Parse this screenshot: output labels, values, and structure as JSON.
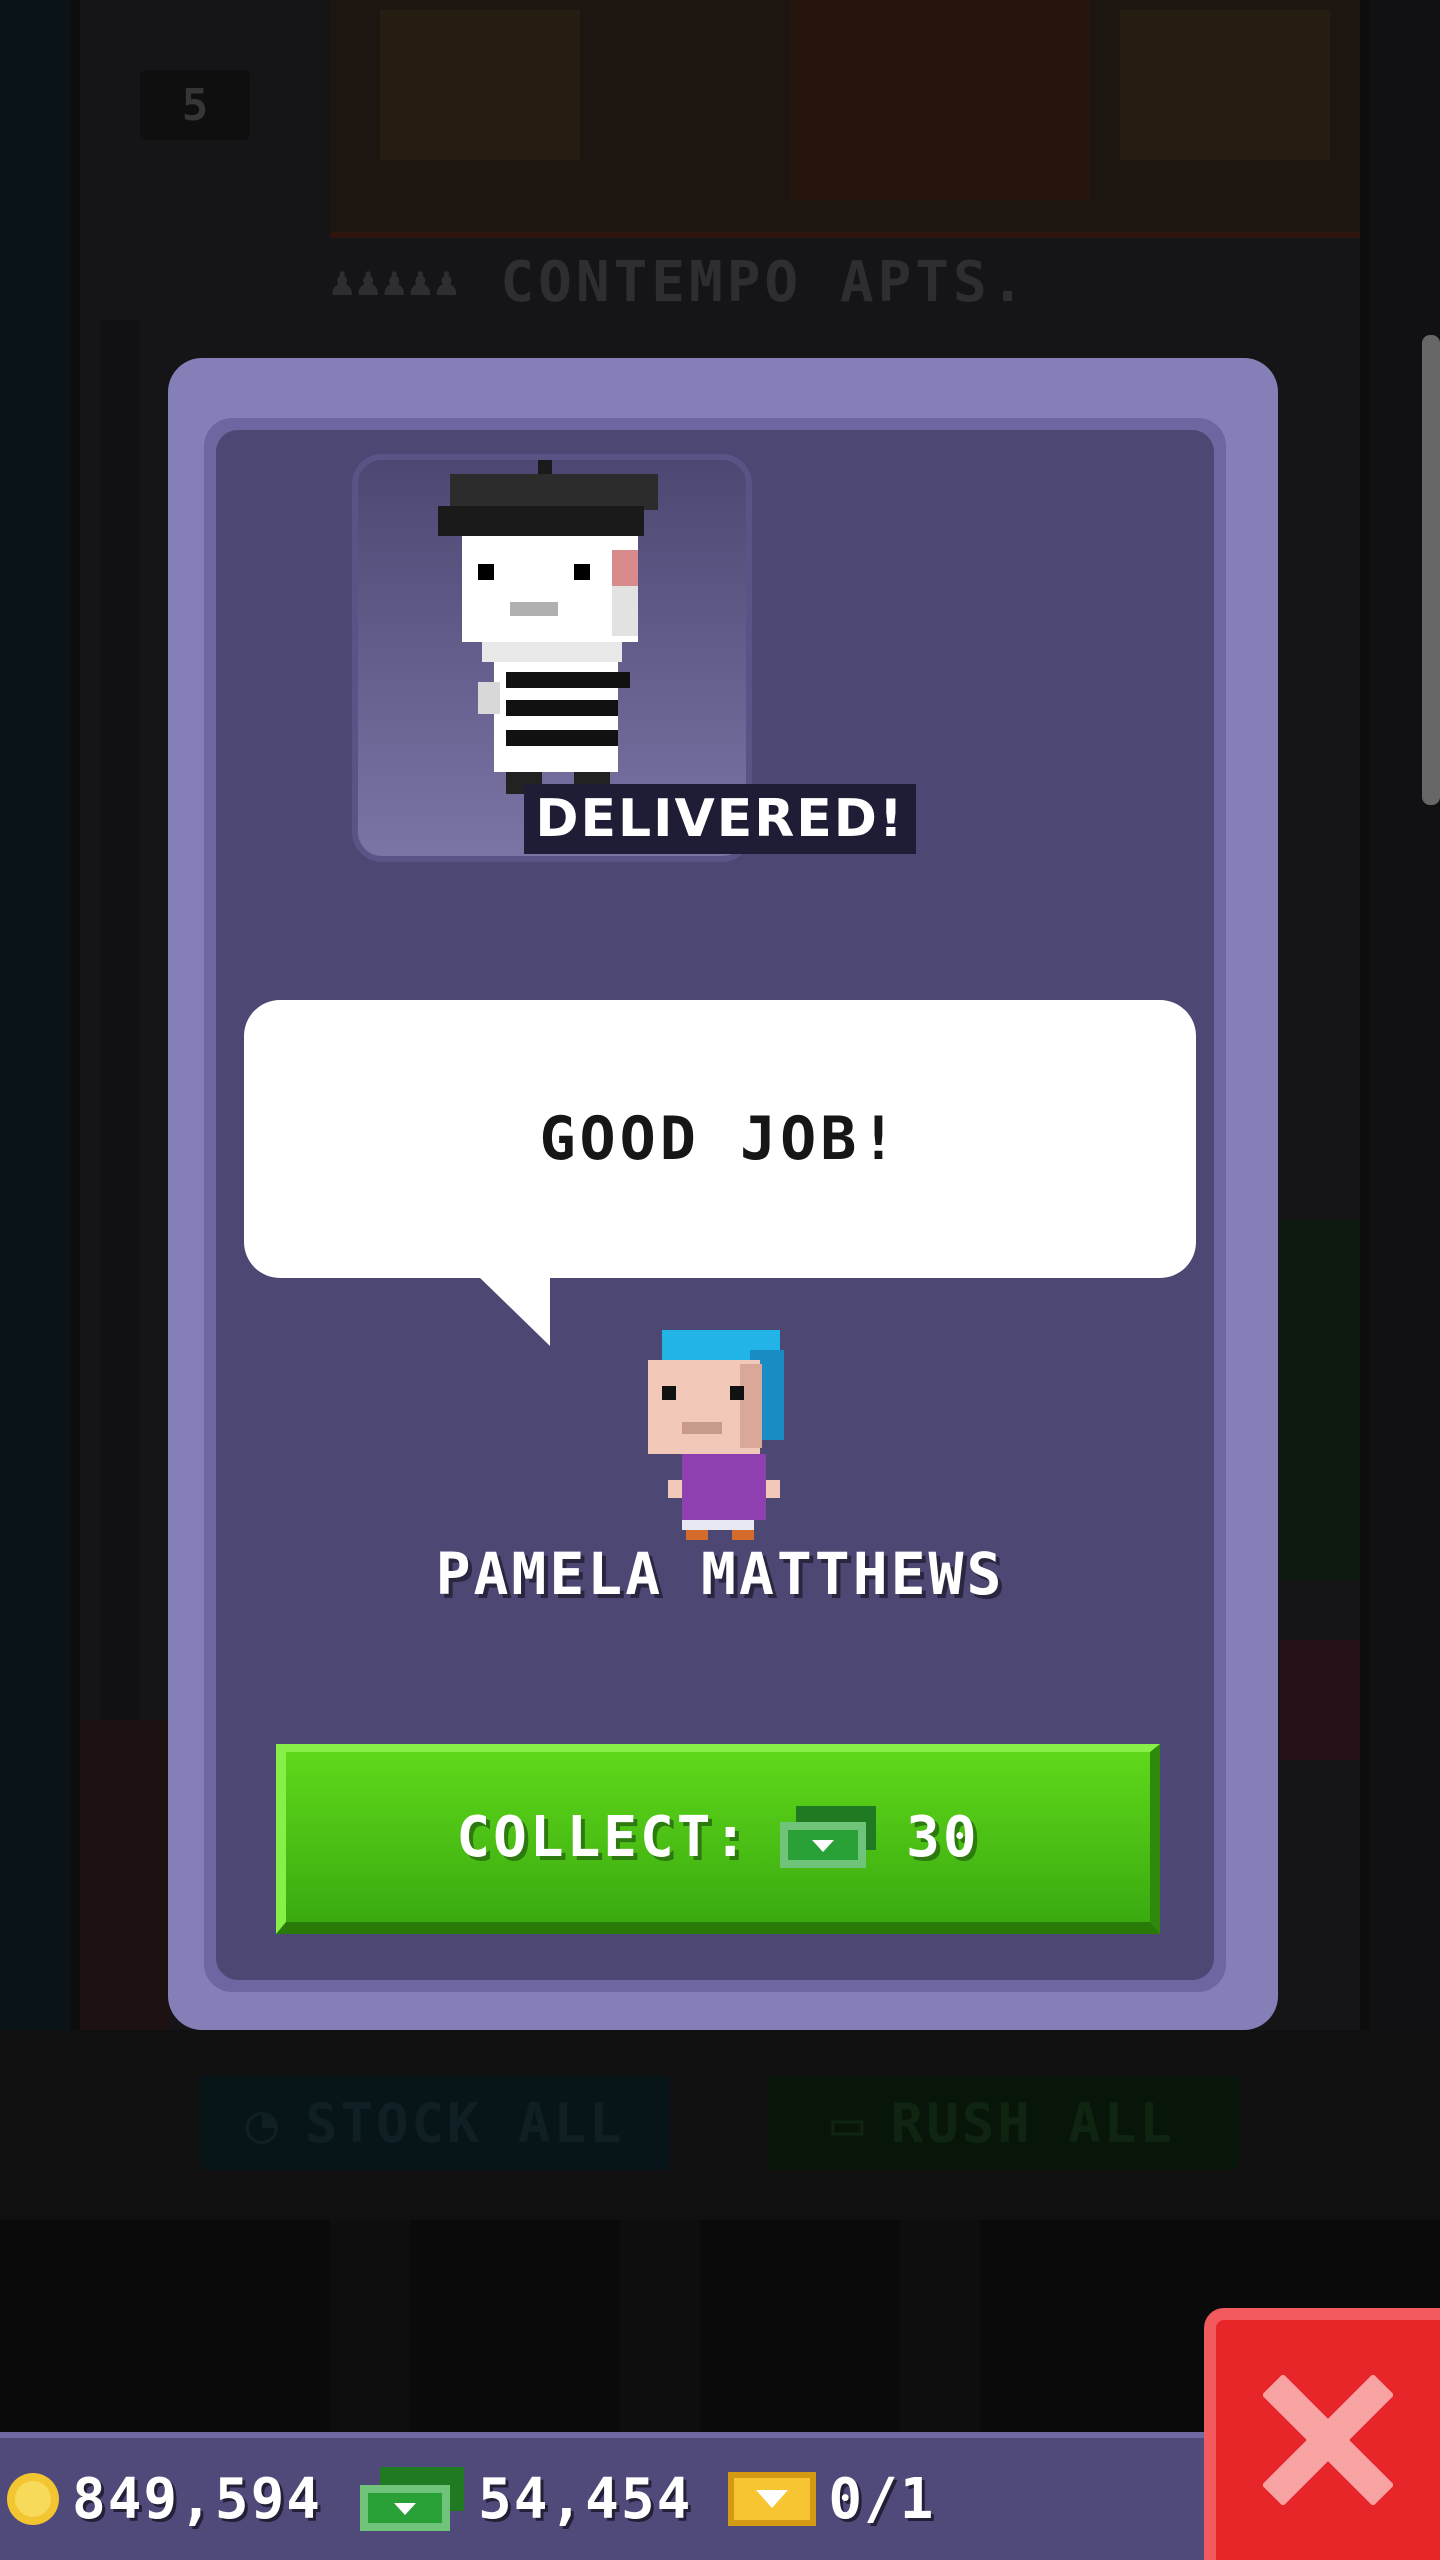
{
  "background": {
    "floor_label": "CONTEMPO APTS.",
    "floor_number": "5",
    "stock_all_label": "STOCK ALL",
    "rush_all_label": "RUSH ALL"
  },
  "dialog": {
    "status_banner": "DELIVERED!",
    "speech_text": "GOOD JOB!",
    "bitizen_name": "PAMELA MATTHEWS",
    "collect_label": "COLLECT:",
    "collect_amount": "30"
  },
  "resources": {
    "coins": "849,594",
    "bux": "54,454",
    "tickets": "0/1"
  },
  "icons": {
    "coin": "coin-icon",
    "bux": "bux-icon",
    "ticket": "golden-ticket-icon",
    "close": "close-icon",
    "clock": "clock-icon"
  },
  "colors": {
    "modal_frame": "#857fb8",
    "modal_body": "#4d4773",
    "collect_green": "#4fc316",
    "close_red": "#e8262a",
    "resource_bar": "#4f4a7a"
  }
}
